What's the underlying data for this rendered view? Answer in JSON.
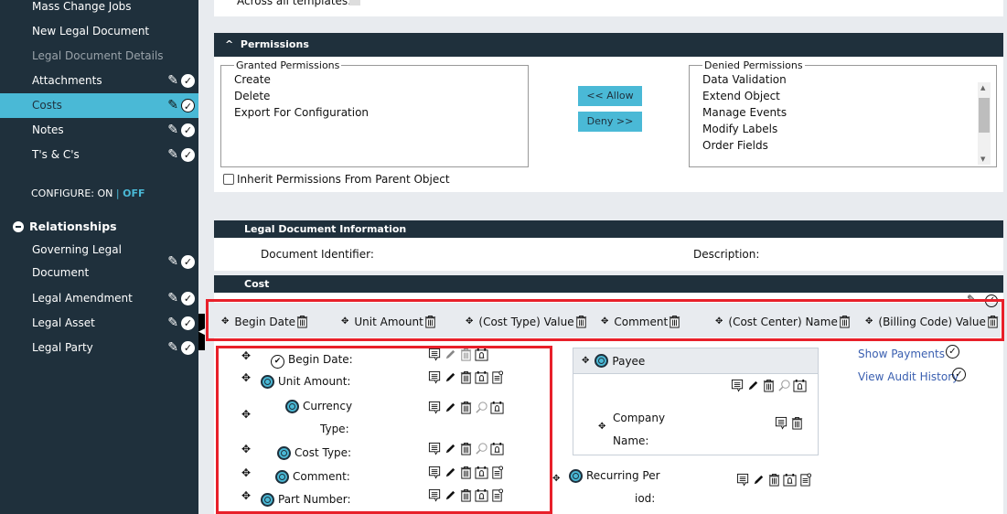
{
  "sidebar": {
    "items": [
      {
        "label": "Mass Change Jobs"
      },
      {
        "label": "New Legal Document"
      },
      {
        "label": "Legal Document Details"
      },
      {
        "label": "Attachments"
      },
      {
        "label": "Costs"
      },
      {
        "label": "Notes"
      },
      {
        "label": "T's & C's"
      }
    ],
    "configure_label": "CONFIGURE: ON",
    "configure_sep": "|",
    "configure_off": "OFF",
    "relationships_title": "Relationships",
    "relationships": [
      {
        "label1": "Governing Legal",
        "label2": "Document"
      },
      {
        "label1": "Legal Amendment"
      },
      {
        "label1": "Legal Asset"
      },
      {
        "label1": "Legal Party"
      }
    ]
  },
  "top": {
    "across_label": "Across all templates:"
  },
  "permissions": {
    "title": "Permissions",
    "granted_legend": "Granted Permissions",
    "granted": [
      "Create",
      "Delete",
      "Export For Configuration"
    ],
    "allow": "<< Allow",
    "deny": "Deny >>",
    "denied_legend": "Denied Permissions",
    "denied": [
      "Data Validation",
      "Extend Object",
      "Manage Events",
      "Modify Labels",
      "Order Fields"
    ],
    "inherit": "Inherit Permissions From Parent Object"
  },
  "ldi": {
    "title": "Legal Document Information",
    "doc_id": "Document Identifier:",
    "desc": "Description:"
  },
  "cost": {
    "title": "Cost",
    "columns": [
      "Begin Date",
      "Unit Amount",
      "(Cost Type) Value",
      "Comment",
      "(Cost Center) Name",
      "(Billing Code) Value"
    ],
    "fields": [
      {
        "label": "Begin Date:"
      },
      {
        "label": "Unit Amount:"
      },
      {
        "label": "Currency",
        "label2": "Type:"
      },
      {
        "label": "Cost Type:"
      },
      {
        "label": "Comment:"
      },
      {
        "label": "Part Number:"
      }
    ],
    "payee": "Payee",
    "company": "Company",
    "company2": "Name:",
    "recurring": "Recurring Per",
    "recurring2": "iod:",
    "show_payments": "Show Payments",
    "audit": "View Audit History"
  },
  "colors": {
    "sidebar": "#1f303c",
    "accent": "#4ab9d6",
    "highlight": "#e8202a"
  }
}
